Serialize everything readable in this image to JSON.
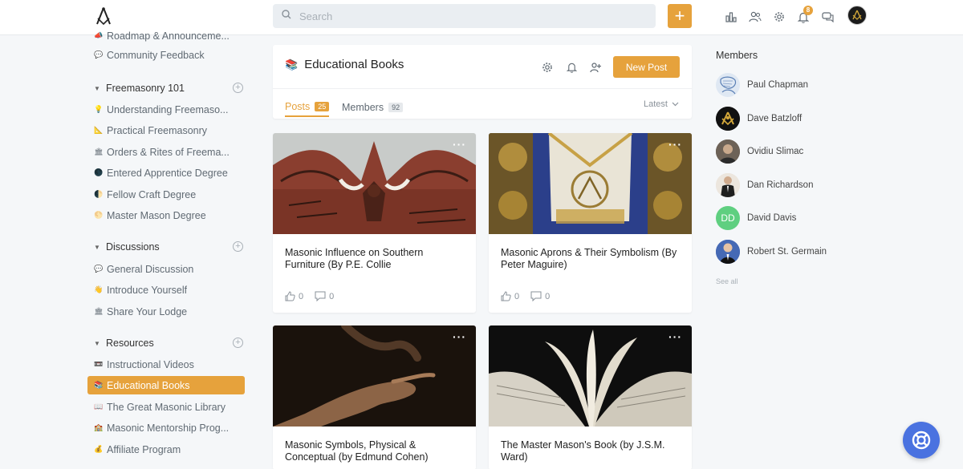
{
  "topbar": {
    "search_placeholder": "Search",
    "notification_count": "8",
    "colors": {
      "accent": "#e6a23c",
      "help": "#4a72e0"
    }
  },
  "sidebar": {
    "top_items": [
      {
        "label": "Roadmap & Announceme...",
        "icon": "megaphone-icon"
      },
      {
        "label": "Community Feedback",
        "icon": "speech-bubble-icon"
      }
    ],
    "groups": [
      {
        "title": "Freemasonry 101",
        "items": [
          {
            "label": "Understanding Freemaso...",
            "icon": "lightbulb-icon"
          },
          {
            "label": "Practical Freemasonry",
            "icon": "set-square-icon"
          },
          {
            "label": "Orders & Rites of Freema...",
            "icon": "temple-icon"
          },
          {
            "label": "Entered Apprentice Degree",
            "icon": "new-moon-icon"
          },
          {
            "label": "Fellow Craft Degree",
            "icon": "half-moon-icon"
          },
          {
            "label": "Master Mason Degree",
            "icon": "full-moon-icon"
          }
        ]
      },
      {
        "title": "Discussions",
        "items": [
          {
            "label": "General Discussion",
            "icon": "speech-bubble-icon"
          },
          {
            "label": "Introduce Yourself",
            "icon": "waving-hand-icon"
          },
          {
            "label": "Share Your Lodge",
            "icon": "temple-icon"
          }
        ]
      },
      {
        "title": "Resources",
        "items": [
          {
            "label": "Instructional Videos",
            "icon": "video-icon"
          },
          {
            "label": "Educational Books",
            "icon": "books-icon",
            "active": true
          },
          {
            "label": "The Great Masonic Library",
            "icon": "open-book-icon"
          },
          {
            "label": "Masonic Mentorship Prog...",
            "icon": "school-icon"
          },
          {
            "label": "Affiliate Program",
            "icon": "money-bag-icon"
          }
        ]
      }
    ]
  },
  "space": {
    "title": "Educational Books",
    "new_post_label": "New Post",
    "tabs": [
      {
        "label": "Posts",
        "count": "25"
      },
      {
        "label": "Members",
        "count": "92"
      }
    ],
    "sort_label": "Latest"
  },
  "posts": [
    {
      "title": "Masonic Influence on Southern Furniture (By P.E. Collie",
      "likes": "0",
      "comments": "0",
      "image": "carved-wood-pediment"
    },
    {
      "title": "Masonic Aprons & Their Symbolism (By Peter Maguire)",
      "likes": "0",
      "comments": "0",
      "image": "embroidered-apron"
    },
    {
      "title": "Masonic Symbols, Physical & Conceptual (by Edmund Cohen)",
      "image": "reaching-hands"
    },
    {
      "title": "The Master Mason's Book (by J.S.M. Ward)",
      "image": "open-book"
    }
  ],
  "members": {
    "title": "Members",
    "list": [
      {
        "name": "Paul Chapman",
        "avatar": "sketch-photo"
      },
      {
        "name": "Dave Batzloff",
        "avatar": "masonic-emblem"
      },
      {
        "name": "Ovidiu Slimac",
        "avatar": "photo"
      },
      {
        "name": "Dan Richardson",
        "avatar": "photo"
      },
      {
        "name": "David Davis",
        "initials": "DD",
        "avatar_color": "#5fcf80"
      },
      {
        "name": "Robert St. Germain",
        "avatar": "photo"
      }
    ],
    "see_all": "See all"
  }
}
